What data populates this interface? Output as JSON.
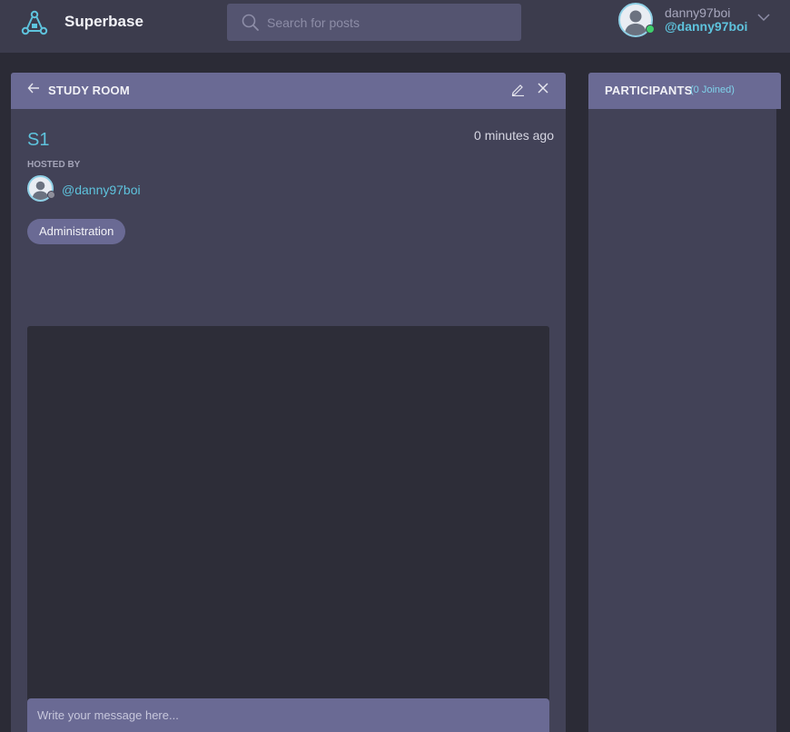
{
  "app": {
    "brand": "Superbase",
    "logo_icon": "network-hub-icon",
    "accent_color": "#5ec3dd"
  },
  "search": {
    "placeholder": "Search for posts",
    "icon": "search-icon"
  },
  "user": {
    "name": "danny97boi",
    "handle": "@danny97boi",
    "status": "online",
    "menu_icon": "chevron-down-icon"
  },
  "room": {
    "header_title": "STUDY ROOM",
    "name": "S1",
    "time_ago": "0 minutes ago",
    "hosted_by_label": "HOSTED BY",
    "host_handle": "@danny97boi",
    "host_status": "offline",
    "tag": "Administration",
    "message_placeholder": "Write your message here..."
  },
  "participants": {
    "title": "PARTICIPANTS",
    "joined": "(0 Joined)"
  }
}
